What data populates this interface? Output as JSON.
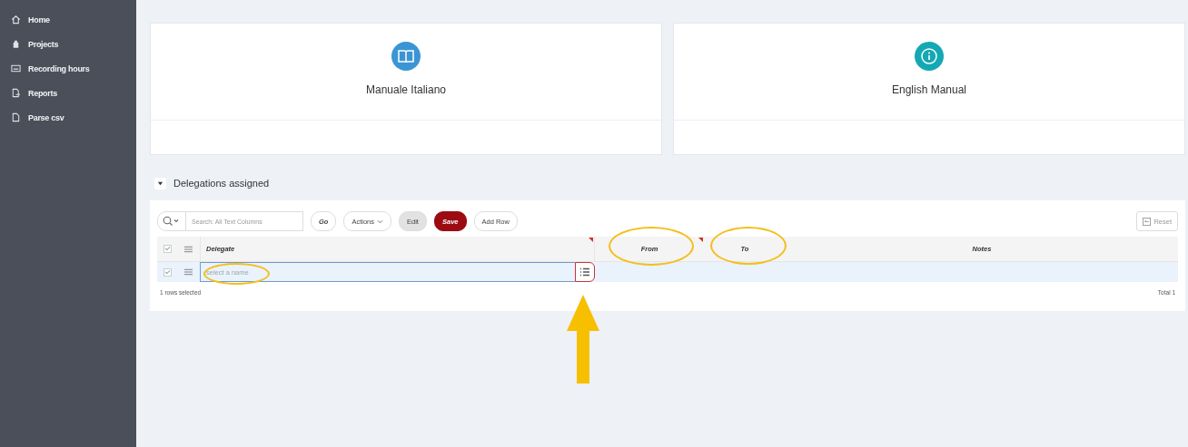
{
  "sidebar": {
    "items": [
      {
        "label": "Home",
        "selected": false
      },
      {
        "label": "Projects",
        "selected": false
      },
      {
        "label": "Recording hours",
        "selected": false
      },
      {
        "label": "Reports",
        "selected": false
      },
      {
        "label": "Parse csv",
        "selected": false
      }
    ]
  },
  "cards": [
    {
      "title": "Manuale Italiano",
      "color": "#3b95d4"
    },
    {
      "title": "English Manual",
      "color": "#14a8b4"
    }
  ],
  "region": {
    "title": "Delegations assigned",
    "expanded": true,
    "toolbar": {
      "search_placeholder": "Search: All Text Columns",
      "go": "Go",
      "actions": "Actions",
      "edit": "Edit",
      "save": "Save",
      "add_row": "Add Row",
      "reset": "Reset"
    },
    "columns": [
      {
        "label": "Delegate",
        "sortable": true
      },
      {
        "label": "From",
        "sortable": true
      },
      {
        "label": "To",
        "sortable": false
      },
      {
        "label": "Notes",
        "sortable": false
      }
    ],
    "header_checked": true,
    "rows": [
      {
        "selected": true,
        "delegate_placeholder": "select a name"
      }
    ],
    "footer_left": "1 rows selected",
    "footer_right": "Total 1"
  }
}
